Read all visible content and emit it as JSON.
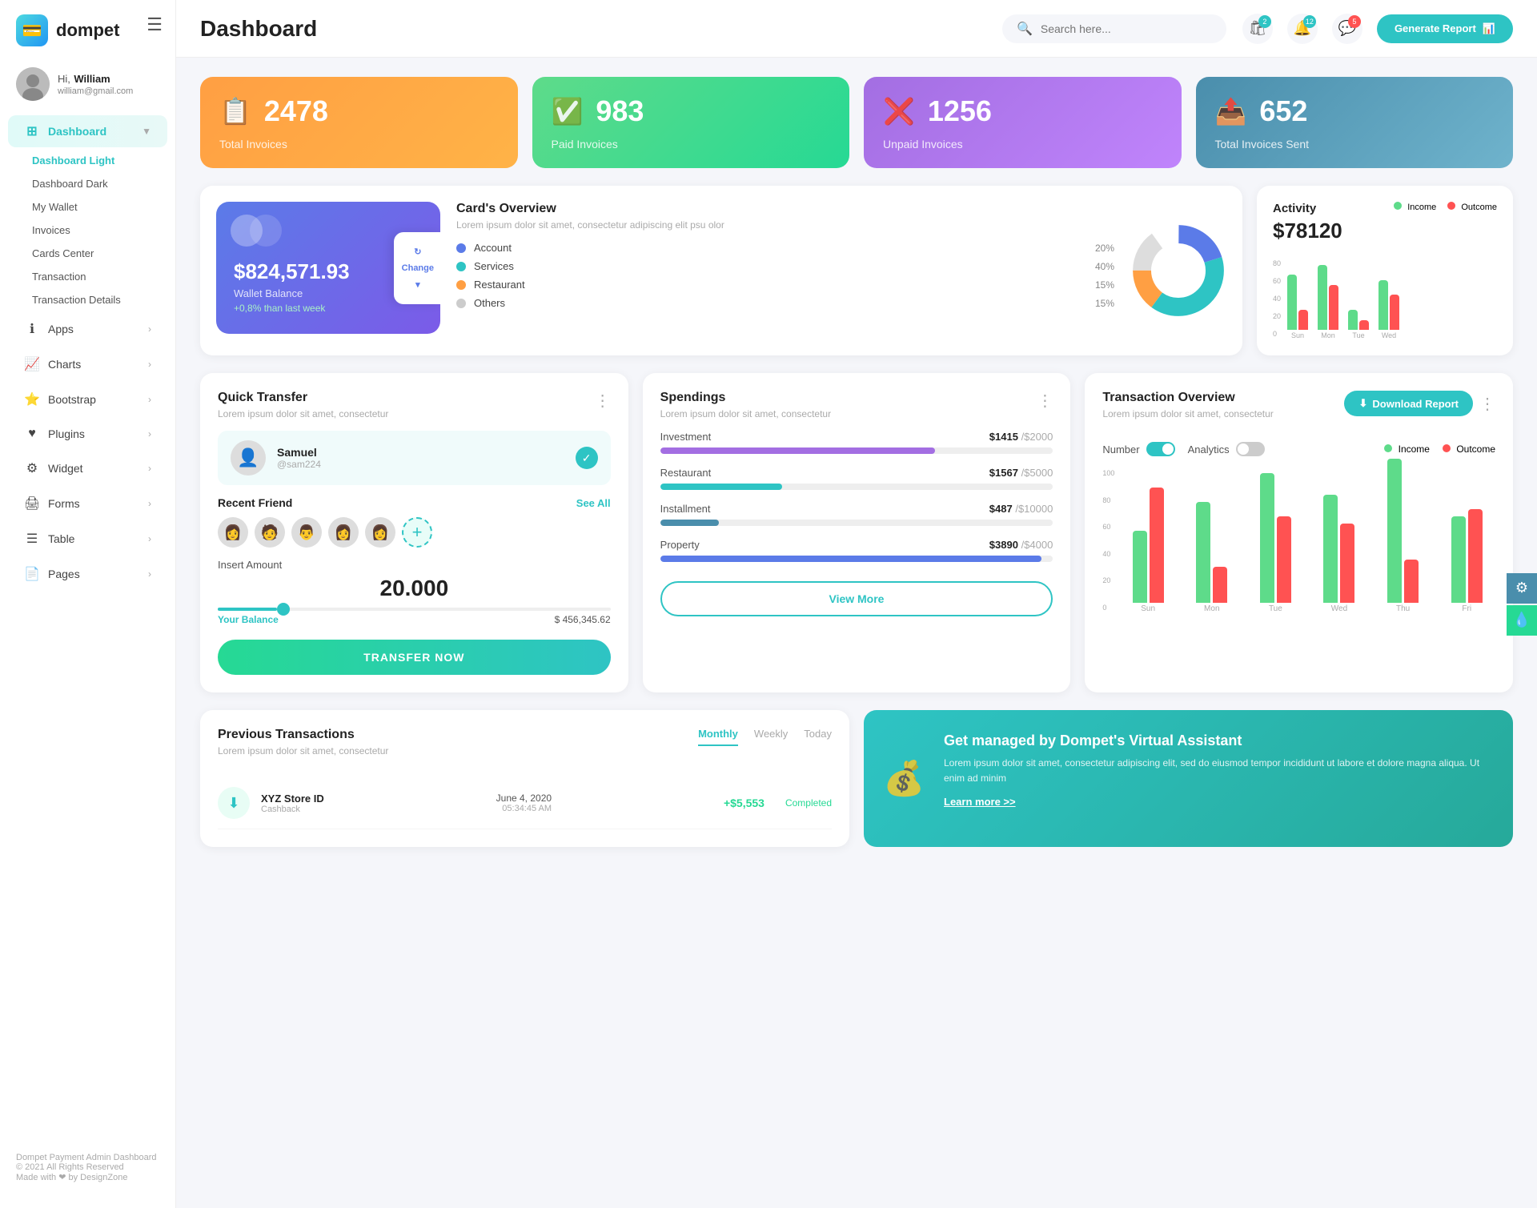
{
  "app": {
    "logo": "dompet",
    "logo_icon": "💳"
  },
  "user": {
    "greeting": "Hi,",
    "name": "William",
    "email": "william@gmail.com"
  },
  "header": {
    "title": "Dashboard",
    "search_placeholder": "Search here...",
    "generate_btn": "Generate Report"
  },
  "header_icons": {
    "bag_badge": "2",
    "bell_badge": "12",
    "chat_badge": "5"
  },
  "stats": [
    {
      "num": "2478",
      "label": "Total Invoices",
      "color": "stat-orange",
      "icon": "📋"
    },
    {
      "num": "983",
      "label": "Paid Invoices",
      "color": "stat-green",
      "icon": "✅"
    },
    {
      "num": "1256",
      "label": "Unpaid Invoices",
      "color": "stat-purple",
      "icon": "❌"
    },
    {
      "num": "652",
      "label": "Total Invoices Sent",
      "color": "stat-teal",
      "icon": "📤"
    }
  ],
  "wallet": {
    "balance": "$824,571.93",
    "label": "Wallet Balance",
    "change": "+0,8% than last week",
    "change_btn": "Change"
  },
  "cards_overview": {
    "title": "Card's Overview",
    "subtitle": "Lorem ipsum dolor sit amet, consectetur adipiscing elit psu olor",
    "legends": [
      {
        "label": "Account",
        "color": "#5b7be8",
        "pct": "20%"
      },
      {
        "label": "Services",
        "color": "#2ec4c4",
        "pct": "40%"
      },
      {
        "label": "Restaurant",
        "color": "#ff9f43",
        "pct": "15%"
      },
      {
        "label": "Others",
        "color": "#ccc",
        "pct": "15%"
      }
    ]
  },
  "activity": {
    "title": "Activity",
    "amount": "$78120",
    "income_label": "Income",
    "outcome_label": "Outcome",
    "bars": [
      {
        "day": "Sun",
        "income": 55,
        "outcome": 20
      },
      {
        "day": "Mon",
        "income": 65,
        "outcome": 45
      },
      {
        "day": "Tue",
        "income": 20,
        "outcome": 10
      },
      {
        "day": "Wed",
        "income": 50,
        "outcome": 35
      }
    ]
  },
  "quick_transfer": {
    "title": "Quick Transfer",
    "subtitle": "Lorem ipsum dolor sit amet, consectetur",
    "featured": {
      "name": "Samuel",
      "handle": "@sam224"
    },
    "recent_friends_label": "Recent Friend",
    "see_all": "See All",
    "insert_amount_label": "Insert Amount",
    "amount": "20.000",
    "your_balance_label": "Your Balance",
    "balance": "$ 456,345.62",
    "transfer_btn": "TRANSFER NOW"
  },
  "spendings": {
    "title": "Spendings",
    "subtitle": "Lorem ipsum dolor sit amet, consectetur",
    "items": [
      {
        "label": "Investment",
        "amount": "$1415",
        "total": "/$2000",
        "pct": 70,
        "color": "progress-purple"
      },
      {
        "label": "Restaurant",
        "amount": "$1567",
        "total": "/$5000",
        "pct": 31,
        "color": "progress-teal"
      },
      {
        "label": "Installment",
        "amount": "$487",
        "total": "/$10000",
        "pct": 15,
        "color": "progress-blue"
      },
      {
        "label": "Property",
        "amount": "$3890",
        "total": "/$4000",
        "pct": 97,
        "color": "progress-indigo"
      }
    ],
    "view_more": "View More"
  },
  "tx_overview": {
    "title": "Transaction Overview",
    "subtitle": "Lorem ipsum dolor sit amet, consectetur",
    "download_btn": "Download Report",
    "number_label": "Number",
    "analytics_label": "Analytics",
    "income_label": "Income",
    "outcome_label": "Outcome",
    "bars": [
      {
        "day": "Sun",
        "income": 50,
        "outcome": 80
      },
      {
        "day": "Mon",
        "income": 70,
        "outcome": 25
      },
      {
        "day": "Tue",
        "income": 90,
        "outcome": 60
      },
      {
        "day": "Wed",
        "income": 75,
        "outcome": 55
      },
      {
        "day": "Thu",
        "income": 100,
        "outcome": 30
      },
      {
        "day": "Fri",
        "income": 60,
        "outcome": 65
      }
    ],
    "y_labels": [
      "100",
      "80",
      "60",
      "40",
      "20",
      "0"
    ]
  },
  "prev_transactions": {
    "title": "Previous Transactions",
    "subtitle": "Lorem ipsum dolor sit amet, consectetur",
    "tabs": [
      "Monthly",
      "Weekly",
      "Today"
    ],
    "active_tab": "Monthly",
    "items": [
      {
        "name": "XYZ Store ID",
        "type": "Cashback",
        "date": "June 4, 2020",
        "time": "05:34:45 AM",
        "amount": "+$5,553",
        "status": "Completed"
      }
    ]
  },
  "virtual_assistant": {
    "title": "Get managed by Dompet's Virtual Assistant",
    "text": "Lorem ipsum dolor sit amet, consectetur adipiscing elit, sed do eiusmod tempor incididunt ut labore et dolore magna aliqua. Ut enim ad minim",
    "link": "Learn more >>"
  },
  "sidebar": {
    "nav_items": [
      {
        "id": "dashboard",
        "label": "Dashboard",
        "icon": "⊞",
        "has_arrow": true,
        "active": true
      },
      {
        "id": "apps",
        "label": "Apps",
        "icon": "ℹ",
        "has_arrow": true
      },
      {
        "id": "charts",
        "label": "Charts",
        "icon": "📈",
        "has_arrow": true
      },
      {
        "id": "bootstrap",
        "label": "Bootstrap",
        "icon": "⭐",
        "has_arrow": true
      },
      {
        "id": "plugins",
        "label": "Plugins",
        "icon": "♥",
        "has_arrow": true
      },
      {
        "id": "widget",
        "label": "Widget",
        "icon": "⚙",
        "has_arrow": true
      },
      {
        "id": "forms",
        "label": "Forms",
        "icon": "🖨",
        "has_arrow": true
      },
      {
        "id": "table",
        "label": "Table",
        "icon": "☰",
        "has_arrow": true
      },
      {
        "id": "pages",
        "label": "Pages",
        "icon": "📄",
        "has_arrow": true
      }
    ],
    "submenu": [
      {
        "id": "dashboard-light",
        "label": "Dashboard Light",
        "active": true
      },
      {
        "id": "dashboard-dark",
        "label": "Dashboard Dark"
      },
      {
        "id": "my-wallet",
        "label": "My Wallet"
      },
      {
        "id": "invoices",
        "label": "Invoices"
      },
      {
        "id": "cards-center",
        "label": "Cards Center"
      },
      {
        "id": "transaction",
        "label": "Transaction"
      },
      {
        "id": "transaction-details",
        "label": "Transaction Details"
      }
    ],
    "footer1": "Dompet Payment Admin Dashboard",
    "footer2": "© 2021 All Rights Reserved",
    "footer3": "Made with ❤ by DesignZone"
  }
}
